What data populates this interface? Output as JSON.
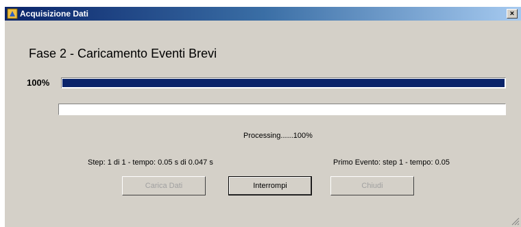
{
  "window": {
    "title": "Acquisizione Dati",
    "close_label": "×"
  },
  "header": {
    "phase_title": "Fase 2 - Caricamento Eventi Brevi"
  },
  "progress": {
    "percent_label": "100%",
    "main_fraction": 1.0,
    "secondary_fraction": 0.0
  },
  "status": {
    "processing": "Processing......100%",
    "step": "Step: 1 di 1 - tempo: 0.05 s di 0.047 s",
    "primo_evento": "Primo Evento: step 1 - tempo: 0.05"
  },
  "buttons": {
    "carica": "Carica Dati",
    "interrompi": "Interrompi",
    "chiudi": "Chiudi"
  },
  "colors": {
    "title_bar": "#0a246a",
    "progress_fill": "#0a246a",
    "window_bg": "#d4d0c8"
  },
  "icons": {
    "app": "app-icon",
    "close": "close-icon",
    "grip": "resize-grip-icon"
  }
}
